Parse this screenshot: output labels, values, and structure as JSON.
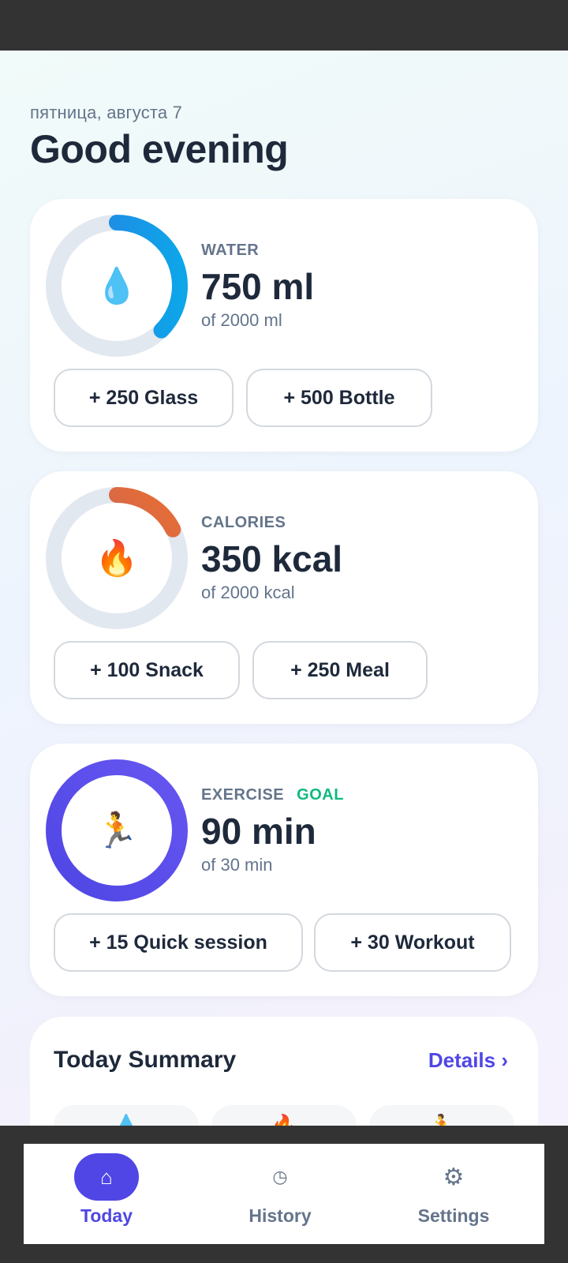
{
  "header": {
    "date": "пятница, августа 7",
    "greeting": "Good evening"
  },
  "cards": {
    "water": {
      "label": "WATER",
      "value": "750 ml",
      "target": "of 2000 ml",
      "progress": 0.375,
      "icon": "water-drop-icon",
      "emoji": "💧",
      "colors": [
        "#0ea5e9",
        "#2a7de1"
      ],
      "buttons": [
        "+ 250 Glass",
        "+ 500 Bottle"
      ]
    },
    "calories": {
      "label": "CALORIES",
      "value": "350 kcal",
      "target": "of 2000 kcal",
      "progress": 0.175,
      "icon": "fire-icon",
      "emoji": "🔥",
      "colors": [
        "#ea6f2f",
        "#b15a7a"
      ],
      "buttons": [
        "+ 100 Snack",
        "+ 250 Meal"
      ]
    },
    "exercise": {
      "label": "EXERCISE",
      "badge": "GOAL",
      "value": "90 min",
      "target": "of 30 min",
      "progress": 1.0,
      "icon": "running-person-icon",
      "emoji": "🏃",
      "colors": [
        "#5b4cf0",
        "#4f46e5"
      ],
      "buttons": [
        "+ 15 Quick session",
        "+ 30 Workout"
      ]
    }
  },
  "summary": {
    "title": "Today Summary",
    "details_link": "Details ›",
    "tiles": [
      "water-drop-icon",
      "fire-icon",
      "running-person-icon"
    ]
  },
  "nav": {
    "items": [
      {
        "label": "Today",
        "icon": "home-icon",
        "glyph": "⌂",
        "active": true
      },
      {
        "label": "History",
        "icon": "clock-icon",
        "glyph": "◷",
        "active": false
      },
      {
        "label": "Settings",
        "icon": "gear-icon",
        "glyph": "⚙",
        "active": false
      }
    ]
  },
  "colors": {
    "accent": "#4f46e5",
    "goal": "#10b981",
    "text": "#1e293b",
    "muted": "#64748b",
    "ring_track": "#e2e8f0"
  }
}
